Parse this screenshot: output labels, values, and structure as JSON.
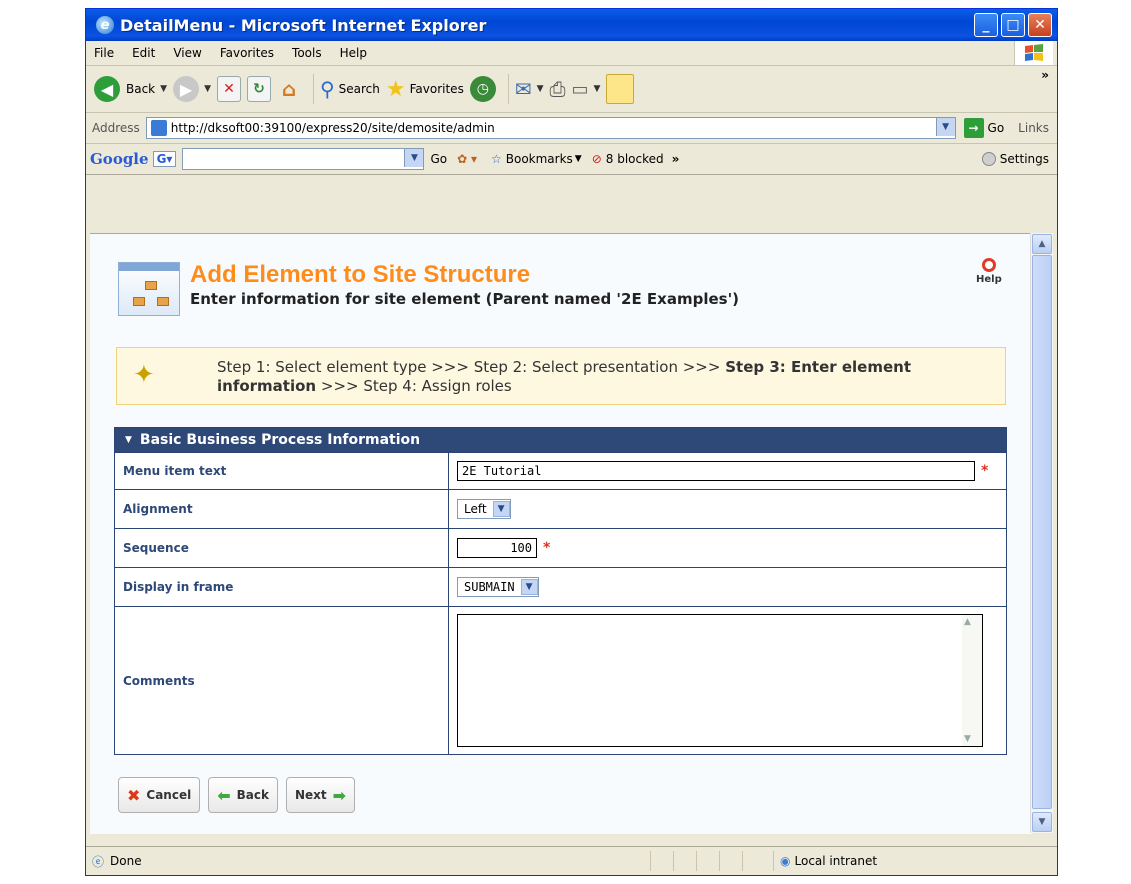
{
  "window": {
    "title": "DetailMenu - Microsoft Internet Explorer"
  },
  "menubar": [
    "File",
    "Edit",
    "View",
    "Favorites",
    "Tools",
    "Help"
  ],
  "toolbar": {
    "back": "Back",
    "search": "Search",
    "favorites": "Favorites"
  },
  "address": {
    "label": "Address",
    "url": "http://dksoft00:39100/express20/site/demosite/admin",
    "go": "Go",
    "links": "Links"
  },
  "googlebar": {
    "logo": "Google",
    "go": "Go",
    "bookmarks": "Bookmarks",
    "blocked": "8 blocked",
    "settings": "Settings"
  },
  "page": {
    "title": "Add Element to Site Structure",
    "subtitle": "Enter information for site element (Parent named '2E Examples')",
    "help": "Help",
    "steps": {
      "s1": "Step 1: Select element type >>> Step 2: Select presentation >>> ",
      "s3": "Step 3: Enter element information",
      "s4": " >>> Step 4: Assign roles"
    },
    "section_title": "Basic Business Process Information",
    "fields": {
      "menu_text_label": "Menu item text",
      "menu_text_value": "2E Tutorial",
      "alignment_label": "Alignment",
      "alignment_value": "Left",
      "sequence_label": "Sequence",
      "sequence_value": "100",
      "frame_label": "Display in frame",
      "frame_value": "SUBMAIN",
      "comments_label": "Comments",
      "comments_value": ""
    },
    "buttons": {
      "cancel": "Cancel",
      "back": "Back",
      "next": "Next"
    }
  },
  "status": {
    "text": "Done",
    "zone": "Local intranet"
  },
  "colors": {
    "title_orange": "#ff8c1a",
    "section_blue": "#2e4877",
    "required_red": "#e03020"
  }
}
